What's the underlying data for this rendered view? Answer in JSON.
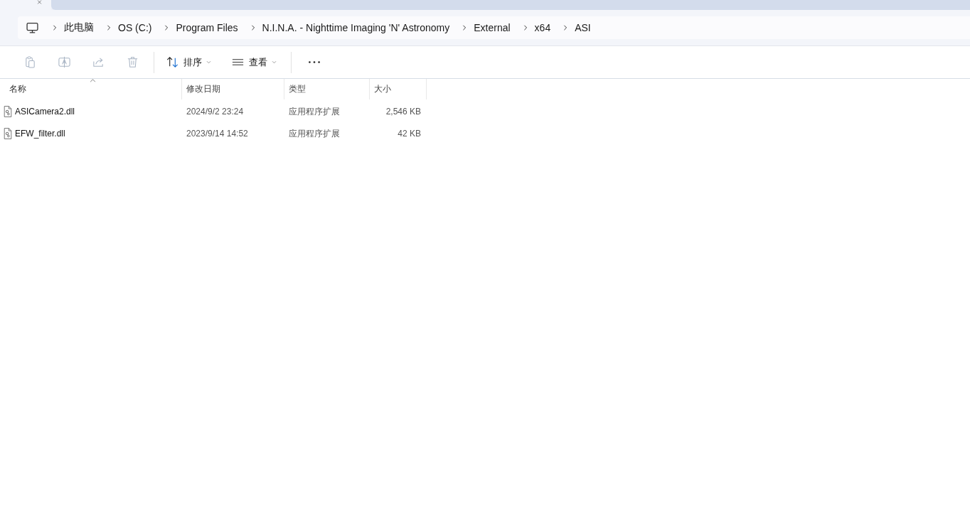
{
  "breadcrumb": [
    "此电脑",
    "OS (C:)",
    "Program Files",
    "N.I.N.A. - Nighttime Imaging 'N' Astronomy",
    "External",
    "x64",
    "ASI"
  ],
  "toolbar": {
    "icon_buttons": [
      {
        "kind": "paste",
        "disabled": true
      },
      {
        "kind": "rename",
        "disabled": true
      },
      {
        "kind": "share",
        "disabled": true
      },
      {
        "kind": "delete",
        "disabled": true
      }
    ],
    "menus": [
      {
        "kind": "sort",
        "label": "排序"
      },
      {
        "kind": "view",
        "label": "查看"
      }
    ]
  },
  "table": {
    "columns": [
      {
        "label": "名称",
        "sorted": true
      },
      {
        "label": "修改日期",
        "sorted": false
      },
      {
        "label": "类型",
        "sorted": false
      },
      {
        "label": "大小",
        "sorted": false
      }
    ],
    "rows": [
      {
        "name": "ASICamera2.dll",
        "modified": "2024/9/2 23:24",
        "type": "应用程序扩展",
        "size": "2,546 KB"
      },
      {
        "name": "EFW_filter.dll",
        "modified": "2023/9/14 14:52",
        "type": "应用程序扩展",
        "size": "42 KB"
      }
    ]
  }
}
